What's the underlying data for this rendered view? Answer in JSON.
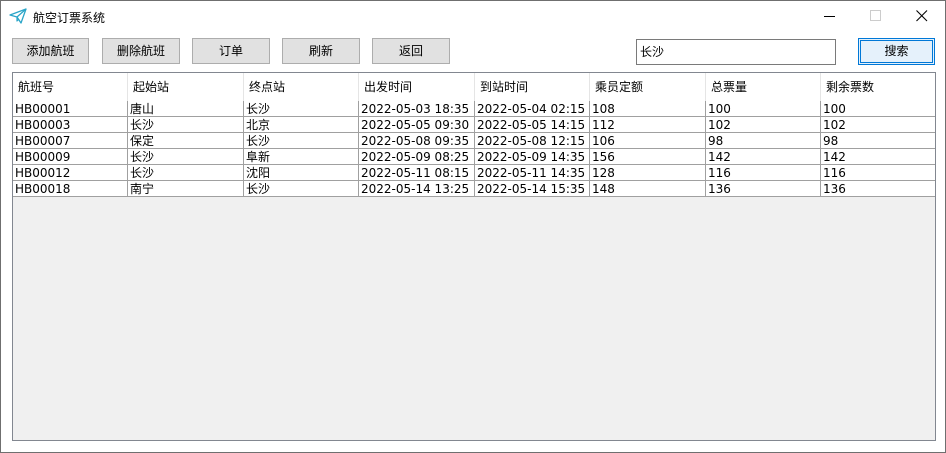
{
  "window": {
    "title": "航空订票系统"
  },
  "toolbar": {
    "add_label": "添加航班",
    "delete_label": "删除航班",
    "order_label": "订单",
    "refresh_label": "刷新",
    "back_label": "返回",
    "search_value": "长沙",
    "search_label": "搜索"
  },
  "table": {
    "columns": [
      "航班号",
      "起始站",
      "终点站",
      "出发时间",
      "到站时间",
      "乘员定额",
      "总票量",
      "剩余票数"
    ],
    "rows": [
      [
        "HB00001",
        "唐山",
        "长沙",
        "2022-05-03 18:35",
        "2022-05-04 02:15",
        "108",
        "100",
        "100"
      ],
      [
        "HB00003",
        "长沙",
        "北京",
        "2022-05-05 09:30",
        "2022-05-05 14:15",
        "112",
        "102",
        "102"
      ],
      [
        "HB00007",
        "保定",
        "长沙",
        "2022-05-08 09:35",
        "2022-05-08 12:15",
        "106",
        "98",
        "98"
      ],
      [
        "HB00009",
        "长沙",
        "阜新",
        "2022-05-09 08:25",
        "2022-05-09 14:35",
        "156",
        "142",
        "142"
      ],
      [
        "HB00012",
        "长沙",
        "沈阳",
        "2022-05-11 08:15",
        "2022-05-11 14:35",
        "128",
        "116",
        "116"
      ],
      [
        "HB00018",
        "南宁",
        "长沙",
        "2022-05-14 13:25",
        "2022-05-14 15:35",
        "148",
        "136",
        "136"
      ]
    ]
  },
  "icons": {
    "app": "paper-plane-icon",
    "minimize": "minimize-icon",
    "maximize": "maximize-icon",
    "close": "close-icon"
  },
  "colors": {
    "accent": "#0078d7",
    "app_icon": "#2aa5c8"
  }
}
